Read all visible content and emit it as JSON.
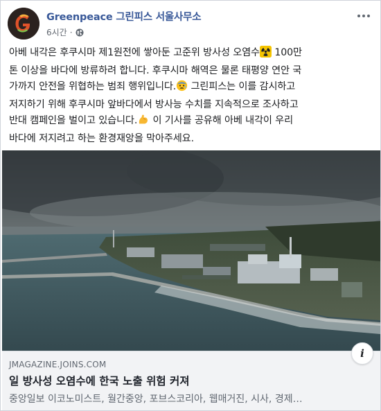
{
  "post": {
    "page_name": "Greenpeace 그린피스 서울사무소",
    "timestamp": "6시간",
    "separator": "·",
    "privacy_icon": "globe-icon",
    "text": {
      "l1a": "아베 내각은 후쿠시마 제1원전에 쌓아둔 고준위 방사성 오염수",
      "l1b": " 100만",
      "l2": "톤 이상을 바다에 방류하려 합니다. 후쿠시마 해역은 물론 태평양 연안 국",
      "l3a": "가까지 안전을 위협하는 범죄 행위입니다.",
      "l3b": " 그린피스는 이를 감시하고",
      "l4": "저지하기 위해 후쿠시마 앞바다에서 방사능 수치를 지속적으로 조사하고",
      "l5a": "반대 캠페인을 벌이고 있습니다.",
      "l5b": " 이 기사를 공유해 아베 내각이 우리",
      "l6": "바다에 저지려고 하는 환경재앙을 막아주세요."
    },
    "emojis": [
      "radioactive-icon",
      "anxious-face-icon",
      "flexed-biceps-icon"
    ]
  },
  "link": {
    "domain": "JMAGAZINE.JOINS.COM",
    "title": "일 방사성 오염수에 한국 노출 위험 커져",
    "description": "중앙일보 이코노미스트, 월간중앙, 포브스코리아, 웹매거진, 시사, 경제…",
    "info_label": "i"
  },
  "colors": {
    "page_name": "#385898",
    "link_bg": "#f2f3f5",
    "meta": "#616770"
  }
}
